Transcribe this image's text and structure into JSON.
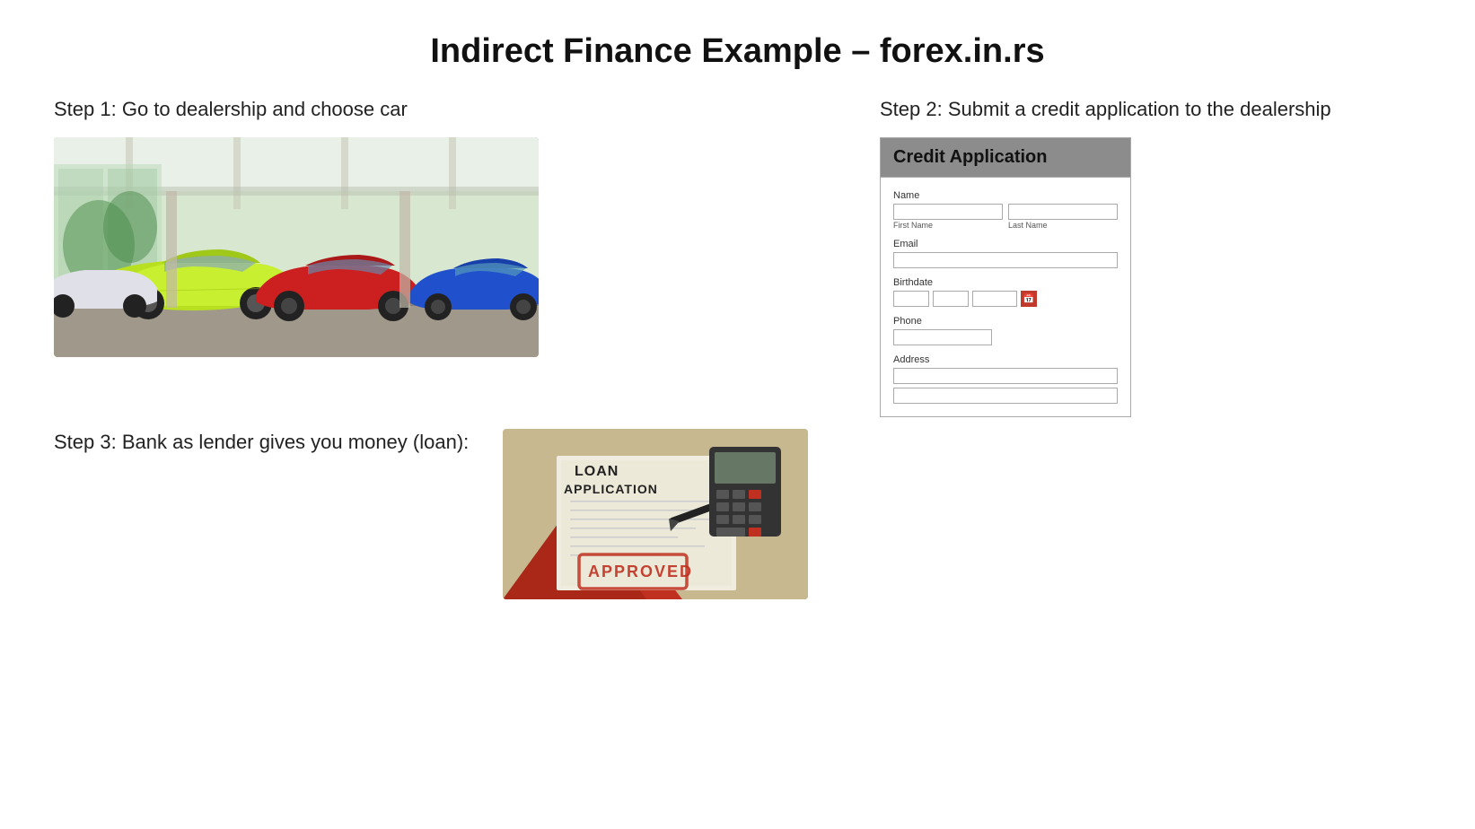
{
  "page": {
    "title": "Indirect Finance Example – forex.in.rs"
  },
  "steps": {
    "step1": {
      "label": "Step 1: Go to dealership and choose car"
    },
    "step2": {
      "label": "Step 2: Submit a credit application to the dealership"
    },
    "step3": {
      "label": "Step 3: Bank as lender gives you money\n(loan):"
    }
  },
  "form": {
    "title": "Credit Application",
    "name_label": "Name",
    "first_name_label": "First Name",
    "last_name_label": "Last Name",
    "email_label": "Email",
    "birthdate_label": "Birthdate",
    "phone_label": "Phone",
    "address_label": "Address"
  },
  "loan_image": {
    "text1": "LOAN",
    "text2": "APPLICATION",
    "stamp": "APPROVED"
  }
}
